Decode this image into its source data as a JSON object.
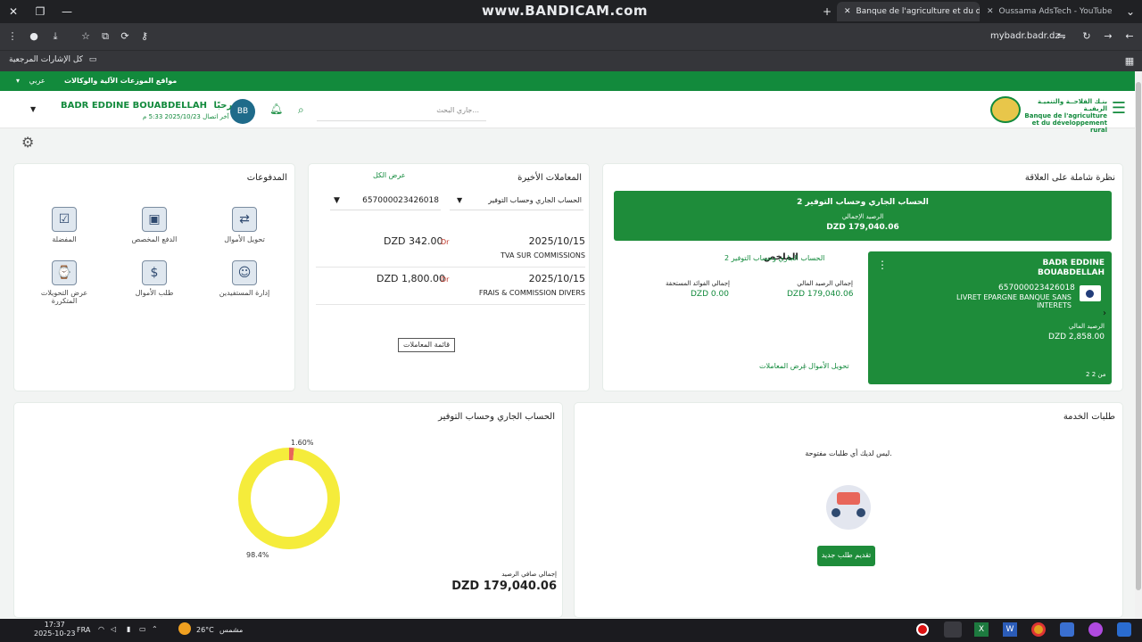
{
  "browser": {
    "recorder_watermark": "www.BANDICAM.com",
    "tabs": [
      {
        "label": "Banque de l'agriculture et du d"
      },
      {
        "label": "Oussama AdsTech - YouTube"
      }
    ],
    "url": "mybadr.badr.dz",
    "bookmarks_label": "كل الإشارات المرجعية"
  },
  "site": {
    "top_links": {
      "language": "عربي",
      "agencies": "مواقع الموزعات الآلية والوكالات"
    },
    "bank_name_ar": "بنـك الفلاحــة والتنميـة الريفيـة",
    "bank_name_fr_1": "Banque de l'agriculture",
    "bank_name_fr_2": "et du développement rural",
    "search_placeholder": "جاري البحث...",
    "user": {
      "initials": "BB",
      "greeting": "مرحبًا،",
      "name": "BADR EDDINE BOUABDELLAH",
      "last_login": "آخر اتصال 2025/10/23 5:33 م"
    }
  },
  "overview": {
    "title": "نظرة شاملة على العلاقة",
    "summary_banner": {
      "title": "2 الحساب الجاري وحساب التوفير",
      "label": "الرصيد الإجمالي",
      "value": "DZD 179,040.06"
    },
    "account_card": {
      "holder_1": "BADR EDDINE",
      "holder_2": "BOUABDELLAH",
      "number": "657000023426018",
      "product_1": "LIVRET EPARGNE BANQUE SANS",
      "product_2": "INTERETS",
      "balance_label": "الرصيد المالي",
      "balance": "DZD 2,858.00",
      "pager": "2 من 2"
    },
    "summary": {
      "title": "الملخص",
      "subtitle": "2 الحساب الجاري وحساب التوفير",
      "total_balance_label": "إجمالي الرصيد المالي",
      "total_balance": "DZD 179,040.06",
      "interest_label": "إجمالي الفوائد المستحقة",
      "interest": "DZD 0.00"
    },
    "links": {
      "transfer": "تحويل الأموال",
      "transactions": "عرض المعاملات"
    }
  },
  "recent": {
    "title": "المعاملات الأخيرة",
    "view_all": "عرض الكل",
    "account_filter": "الحساب الجاري وحساب التوفير",
    "account_number": "657000023426018",
    "rows": [
      {
        "date": "2025/10/15",
        "desc": "TVA SUR COMMISSIONS",
        "amount": "DZD 342.00",
        "type": "Dr"
      },
      {
        "date": "2025/10/15",
        "desc": "FRAIS & COMMISSION DIVERS",
        "amount": "DZD 1,800.00",
        "type": "Dr"
      }
    ],
    "list_button": "قائمة المعاملات"
  },
  "payments": {
    "title": "المدفوعات",
    "items": [
      {
        "label": "تحويل الأموال",
        "icon": "money-transfer-icon"
      },
      {
        "label": "الدفع المخصص",
        "icon": "custom-payment-icon"
      },
      {
        "label": "المفضلة",
        "icon": "favorites-icon"
      },
      {
        "label": "إدارة المستفيدين",
        "icon": "beneficiaries-icon"
      },
      {
        "label": "طلب الأموال",
        "icon": "request-money-icon"
      },
      {
        "label": "عرض التحويلات",
        "label2": "المتكررة",
        "icon": "recurring-transfers-icon"
      }
    ]
  },
  "service": {
    "title": "طلبات الخدمة",
    "empty_text": "ليس لديك أي طلبات مفتوحة.",
    "new_request_button": "تقديم طلب جديد"
  },
  "chart_card": {
    "title": "الحساب الجاري وحساب التوفير",
    "total_label": "إجمالي صافي الرصيد",
    "total": "DZD 179,040.06"
  },
  "chart_data": {
    "type": "pie",
    "categories": [
      "",
      ""
    ],
    "values": [
      98.4,
      1.6
    ],
    "labels": [
      "98.4%",
      "1.60%"
    ],
    "colors": [
      "#f5ec3b",
      "#e8665a"
    ],
    "title": ""
  },
  "taskbar": {
    "weather_text": "مشمس",
    "temperature": "26°C",
    "language": "FRA",
    "time": "17:37",
    "date": "2025-10-23"
  }
}
